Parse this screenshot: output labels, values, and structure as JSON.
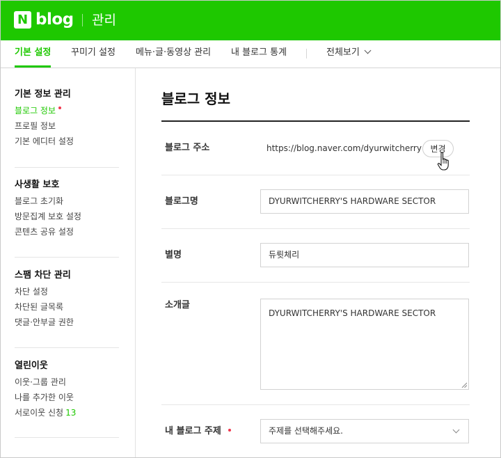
{
  "header": {
    "logo_n": "N",
    "logo_text": "blog",
    "section_title": "관리"
  },
  "tabs": [
    {
      "label": "기본 설정",
      "active": true
    },
    {
      "label": "꾸미기 설정",
      "active": false
    },
    {
      "label": "메뉴·글·동영상 관리",
      "active": false
    },
    {
      "label": "내 블로그 통계",
      "active": false
    },
    {
      "label": "전체보기",
      "active": false
    }
  ],
  "sidebar": {
    "groups": [
      {
        "title": "기본 정보 관리",
        "items": [
          {
            "label": "블로그 정보",
            "active": true,
            "dot": true
          },
          {
            "label": "프로필 정보"
          },
          {
            "label": "기본 에디터 설정"
          }
        ]
      },
      {
        "title": "사생활 보호",
        "items": [
          {
            "label": "블로그 초기화"
          },
          {
            "label": "방문집계 보호 설정"
          },
          {
            "label": "콘텐츠 공유 설정"
          }
        ]
      },
      {
        "title": "스팸 차단 관리",
        "items": [
          {
            "label": "차단 설정"
          },
          {
            "label": "차단된 글목록"
          },
          {
            "label": "댓글·안부글 권한"
          }
        ]
      },
      {
        "title": "열린이웃",
        "items": [
          {
            "label": "이웃·그룹 관리"
          },
          {
            "label": "나를 추가한 이웃"
          },
          {
            "label": "서로이웃 신청",
            "count": "13"
          }
        ]
      }
    ]
  },
  "main": {
    "title": "블로그 정보",
    "address": {
      "label": "블로그 주소",
      "value": "https://blog.naver.com/dyurwitcherry",
      "change_label": "변경"
    },
    "blog_name": {
      "label": "블로그명",
      "value": "DYURWITCHERRY'S HARDWARE SECTOR"
    },
    "nickname": {
      "label": "별명",
      "value": "듀륏체리"
    },
    "intro": {
      "label": "소개글",
      "value": "DYURWITCHERRY'S HARDWARE SECTOR"
    },
    "topic": {
      "label": "내 블로그 주제",
      "required": true,
      "placeholder": "주제를 선택해주세요."
    }
  },
  "colors": {
    "brand_green": "#1ec800",
    "required_red": "#f0364c"
  }
}
